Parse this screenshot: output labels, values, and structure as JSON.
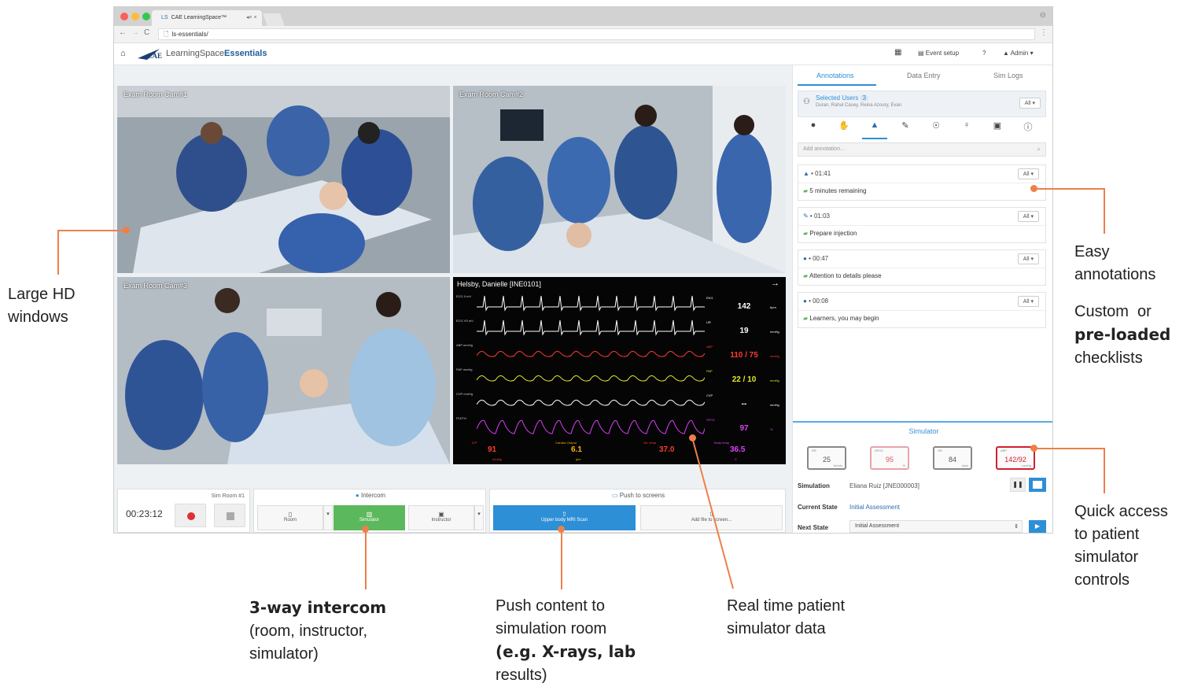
{
  "browser": {
    "tab_title": "CAE LearningSpace™",
    "tab_icon": "LS",
    "tab_controls": "◂× ×",
    "url": "ls-essentials/",
    "nav_back": "←",
    "nav_forward": "→",
    "nav_reload": "C",
    "page_icon": "🗋"
  },
  "app": {
    "logo_cae": "CAE",
    "logo_text": "LearningSpace",
    "logo_ess": "Essentials",
    "event_setup": "Event setup",
    "help": "?",
    "admin": "Admin"
  },
  "cameras": [
    {
      "label": "Exam Room Cam#1"
    },
    {
      "label": "Exam Room Cam#2"
    },
    {
      "label": "Exam Room Cam#3"
    }
  ],
  "monitor": {
    "title": "Helsby, Danielle [INE0101]",
    "rows": [
      {
        "label": "ECG II mV",
        "tag": "EKG",
        "value": "142",
        "unit": "bpm",
        "color": "#ffffff"
      },
      {
        "label": "ECG V5 mV",
        "tag": "UR",
        "value": "19",
        "unit": "mmHg",
        "color": "#ffffff"
      },
      {
        "label": "ABP mmHg",
        "tag": "ABP",
        "value": "110 / 75",
        "unit": "mmHg",
        "color": "#ff3b30"
      },
      {
        "label": "PAP mmHg",
        "tag": "PAP",
        "value": "22 / 10",
        "unit": "mmHg",
        "color": "#e5e82a"
      },
      {
        "label": "CVP mmHg",
        "tag": "CVP",
        "value": "--",
        "unit": "mmHg",
        "color": "#ffffff"
      },
      {
        "label": "PLETH",
        "tag": "SPO2",
        "value": "97",
        "unit": "%",
        "color": "#e040fb"
      }
    ],
    "bottom": [
      {
        "label": "ICP",
        "value": "91",
        "unit": "mmHg",
        "color": "#ff3b30"
      },
      {
        "label": "Cardiac Output",
        "value": "6.1",
        "unit": "lpm",
        "color": "#ffb300"
      },
      {
        "label": "Art. temp",
        "value": "37.0",
        "unit": "",
        "color": "#ff3b30"
      },
      {
        "label": "Body temp",
        "value": "36.5",
        "unit": "C",
        "color": "#e040fb"
      }
    ]
  },
  "recording": {
    "room": "Sim Room #1",
    "timer": "00:23:12"
  },
  "intercom": {
    "title": "Intercom",
    "room": "Room",
    "simulator": "Simulator",
    "instructor": "Instructor"
  },
  "push": {
    "title": "Push to screens",
    "item": "Upper body MRI Scan",
    "add": "Add file to screen..."
  },
  "right": {
    "tabs": [
      "Annotations",
      "Data Entry",
      "Sim Logs"
    ],
    "selected_users": "Selected Users",
    "users_count": "3",
    "users_list": "Duran, Rahul Casey, Reina Azoury, Evan",
    "all": "All",
    "annot_placeholder": "Add annotation...",
    "annotations": [
      {
        "icon": "▲",
        "time": "01:41",
        "text": "5 minutes remaining"
      },
      {
        "icon": "✎",
        "time": "01:03",
        "text": "Prepare injection"
      },
      {
        "icon": "●",
        "time": "00:47",
        "text": "Attention to details please"
      },
      {
        "icon": "●",
        "time": "00:08",
        "text": "Learners, you may begin"
      }
    ],
    "simulator": "Simulator",
    "vitals": [
      {
        "name": "RR",
        "value": "25",
        "unit": "br/min",
        "color": "#555555",
        "border": "#888888"
      },
      {
        "name": "SPO2",
        "value": "95",
        "unit": "%",
        "color": "#e5505f",
        "border": "#e9a3ab"
      },
      {
        "name": "HR",
        "value": "84",
        "unit": "bpm",
        "color": "#555555",
        "border": "#888888"
      },
      {
        "name": "ABP",
        "value": "142/92",
        "unit": "mmHg",
        "color": "#d11f2f",
        "border": "#d11f2f"
      }
    ],
    "simulation_label": "Simulation",
    "simulation_value": "Eliana Ruiz [JNE000003]",
    "current_state_label": "Current State",
    "current_state_value": "Initial Assessment",
    "next_state_label": "Next State",
    "next_state_value": "Initial Assessment"
  },
  "callouts": {
    "large_hd": "Large HD windows",
    "easy": "Easy annotations",
    "custom_pre": "Custom  or",
    "custom_bold": "pre-loaded",
    "custom_post": "checklists",
    "quick": "Quick access to patient simulator controls",
    "intercom_bold": "3-way intercom",
    "intercom_rest": "(room, instructor, simulator)",
    "push_pre": "Push content to simulation room",
    "push_bold": "(e.g. X-rays, lab",
    "push_post": "results)",
    "realtime": "Real time patient simulator data"
  },
  "colors": {
    "accent": "#ee7f4a",
    "blue": "#2d8fd6",
    "green": "#5cb85c"
  }
}
